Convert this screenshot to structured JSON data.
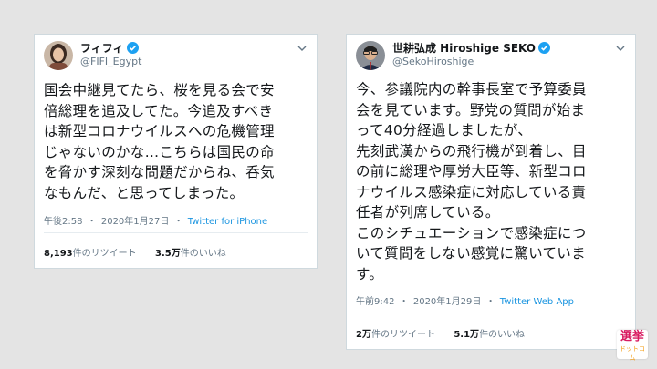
{
  "tweets": [
    {
      "display_name": "フィフィ",
      "handle": "@FIFI_Egypt",
      "text_lines": [
        "国会中継見てたら、桜を見る会で安",
        "倍総理を追及してた。今追及すべき",
        "は新型コロナウイルスへの危機管理",
        "じゃないのかな…こちらは国民の命",
        "を脅かす深刻な問題だからね、呑気",
        "なもんだ、と思ってしまった。"
      ],
      "time": "午後2:58",
      "date": "2020年1月27日",
      "source": "Twitter for iPhone",
      "retweets": "8,193",
      "retweets_label": "件のリツイート",
      "likes": "3.5万",
      "likes_label": "件のいいね"
    },
    {
      "display_name": "世耕弘成 Hiroshige SEKO",
      "handle": "@SekoHiroshige",
      "text_lines": [
        "今、参議院内の幹事長室で予算委員",
        "会を見ています。野党の質問が始ま",
        "って40分経過しましたが、",
        "先刻武漢からの飛行機が到着し、目",
        "の前に総理や厚労大臣等、新型コロ",
        "ナウイルス感染症に対応している責",
        "任者が列席している。",
        "このシチュエーションで感染症につ",
        "いて質問をしない感覚に驚いていま",
        "す。"
      ],
      "time": "午前9:42",
      "date": "2020年1月29日",
      "source": "Twitter Web App",
      "retweets": "2万",
      "retweets_label": "件のリツイート",
      "likes": "5.1万",
      "likes_label": "件のいいね"
    }
  ],
  "meta_separator": "・",
  "logo": {
    "line1": "選挙",
    "line2": "ドットコム"
  },
  "icons": {
    "verified": "verified-badge-icon",
    "chevron": "chevron-down-icon"
  },
  "colors": {
    "background": "#e4e4e4",
    "verified": "#1da1f2",
    "link": "#1b95e0",
    "muted": "#657786",
    "logo_accent": "#d81b60"
  }
}
